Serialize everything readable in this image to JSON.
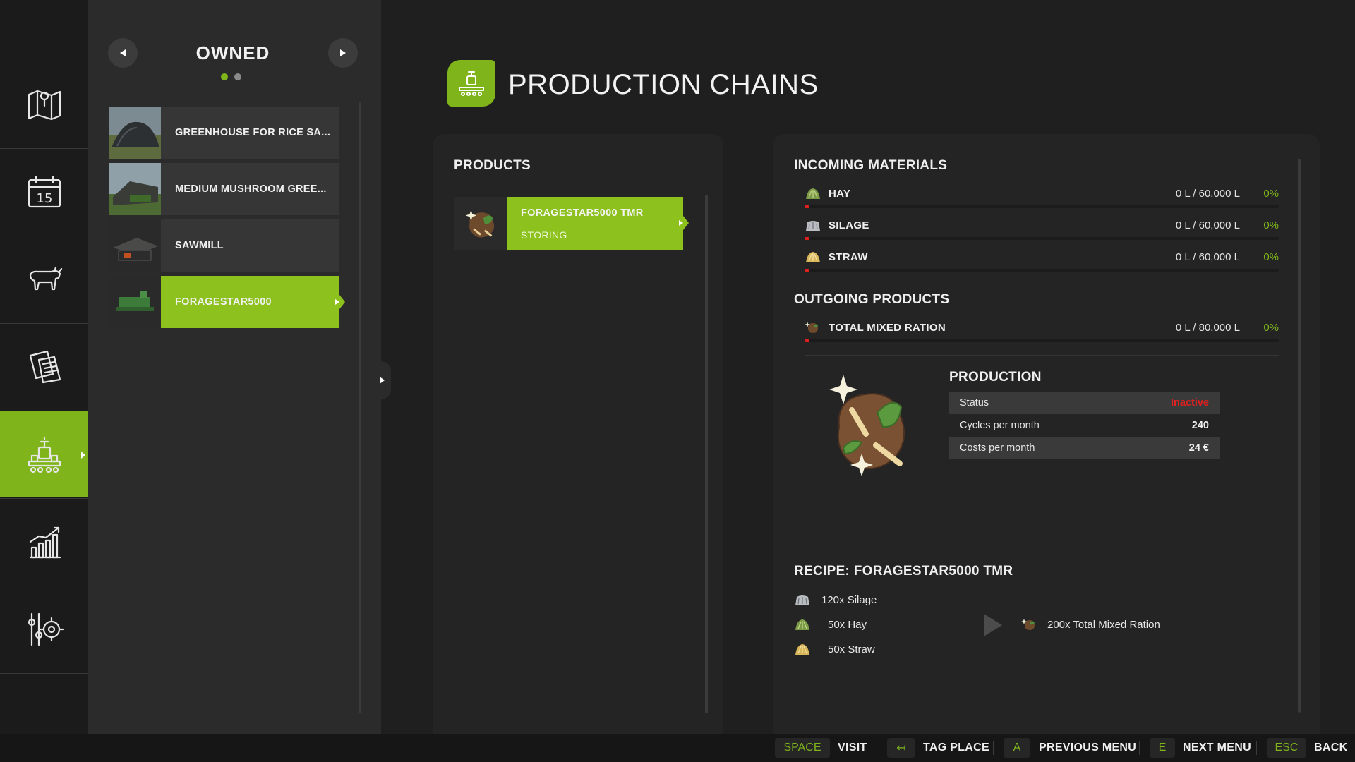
{
  "list_header": {
    "title": "OWNED",
    "page_count": 2,
    "current_page": 1
  },
  "owned_items": [
    {
      "label": "GREENHOUSE FOR RICE SA...",
      "selected": false
    },
    {
      "label": "MEDIUM MUSHROOM GREE...",
      "selected": false
    },
    {
      "label": "SAWMILL",
      "selected": false
    },
    {
      "label": "FORAGESTAR5000",
      "selected": true
    }
  ],
  "page": {
    "title": "PRODUCTION CHAINS"
  },
  "products": {
    "heading": "PRODUCTS",
    "items": [
      {
        "name": "FORAGESTAR5000 TMR",
        "status": "STORING"
      }
    ]
  },
  "incoming": {
    "heading": "INCOMING MATERIALS",
    "items": [
      {
        "icon": "hay-icon",
        "name": "HAY",
        "amount": "0 L / 60,000 L",
        "percent": "0%",
        "fill": 0.01
      },
      {
        "icon": "silage-icon",
        "name": "SILAGE",
        "amount": "0 L / 60,000 L",
        "percent": "0%",
        "fill": 0.01
      },
      {
        "icon": "straw-icon",
        "name": "STRAW",
        "amount": "0 L / 60,000 L",
        "percent": "0%",
        "fill": 0.01
      }
    ]
  },
  "outgoing": {
    "heading": "OUTGOING PRODUCTS",
    "items": [
      {
        "icon": "mixed-ration-icon",
        "name": "TOTAL MIXED RATION",
        "amount": "0 L / 80,000 L",
        "percent": "0%",
        "fill": 0.01
      }
    ]
  },
  "production": {
    "heading": "PRODUCTION",
    "rows": [
      {
        "label": "Status",
        "value": "Inactive"
      },
      {
        "label": "Cycles per month",
        "value": "240"
      },
      {
        "label": "Costs per month",
        "value": "24 €"
      }
    ]
  },
  "recipe": {
    "heading": "RECIPE: FORAGESTAR5000 TMR",
    "inputs": [
      "120x Silage",
      "50x Hay",
      "50x Straw"
    ],
    "output": "200x Total Mixed Ration"
  },
  "bottom_bar": [
    {
      "key": "SPACE",
      "label": "VISIT"
    },
    {
      "key": "↤",
      "label": "TAG PLACE"
    },
    {
      "key": "A",
      "label": "PREVIOUS MENU"
    },
    {
      "key": "E",
      "label": "NEXT MENU"
    },
    {
      "key": "ESC",
      "label": "BACK"
    }
  ],
  "colors": {
    "accent": "#8cc11e",
    "status_inactive": "#e02020",
    "background": "#1f1f1f"
  }
}
